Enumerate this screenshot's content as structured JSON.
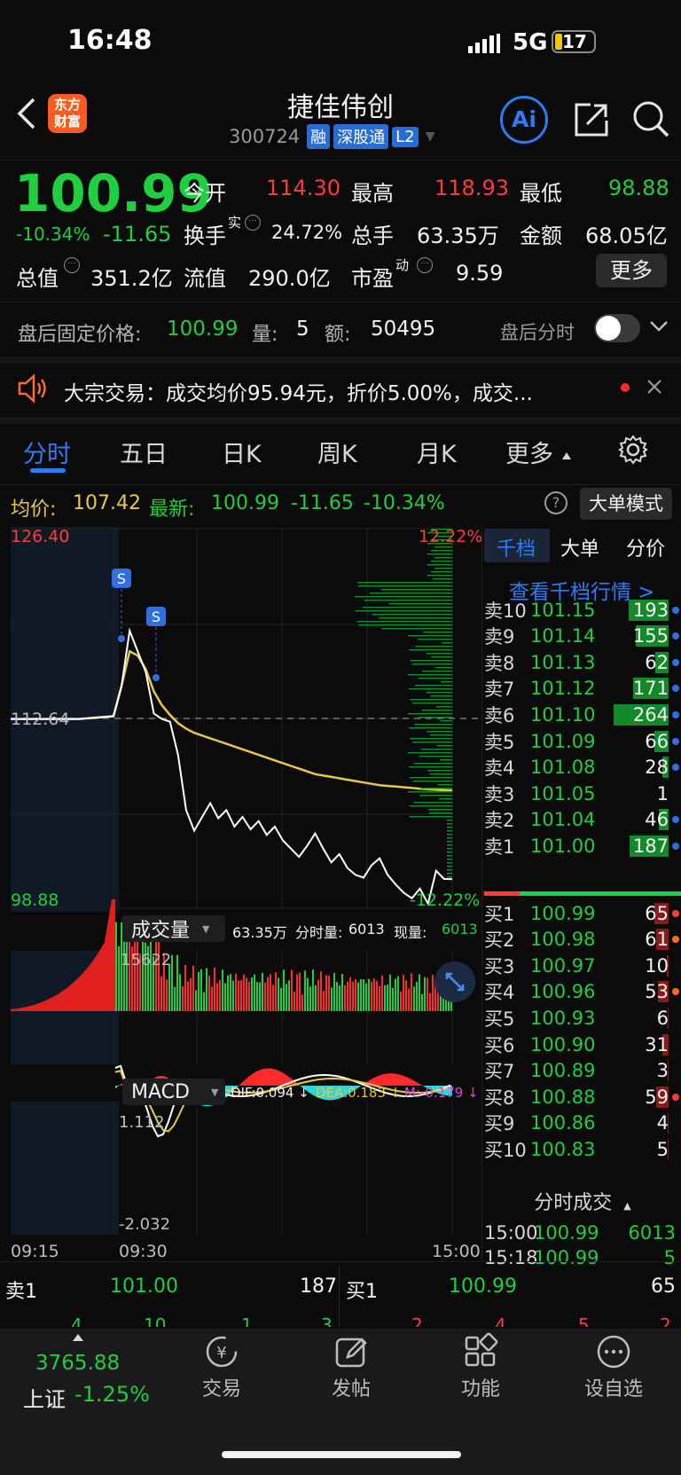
{
  "status_bar": {
    "time": "16:48",
    "network": "5G",
    "battery": "17"
  },
  "header": {
    "title": "捷佳伟创",
    "code": "300724",
    "tags": [
      "融",
      "深股通",
      "L2"
    ],
    "ai_label": "Ai"
  },
  "quote": {
    "price": "100.99",
    "change_pct": "-10.34%",
    "change": "-11.65",
    "open_label": "今开",
    "open": "114.30",
    "high_label": "最高",
    "high": "118.93",
    "low_label": "最低",
    "low": "98.88",
    "turnover_label": "换手",
    "turnover_sup": "实",
    "turnover": "24.72%",
    "volume_label": "总手",
    "volume": "63.35万",
    "amount_label": "金额",
    "amount": "68.05亿",
    "total_value_label": "总值",
    "total_value": "351.2亿",
    "float_value_label": "流值",
    "float_value": "290.0亿",
    "pe_label": "市盈",
    "pe_sup": "动",
    "pe": "9.59",
    "more_label": "更多"
  },
  "after_hours": {
    "label": "盘后固定价格:",
    "price": "100.99",
    "vol_label": "量:",
    "vol": "5",
    "amount_label": "额:",
    "amount": "50495",
    "toggle_label": "盘后分时"
  },
  "news": {
    "text": "大宗交易：成交均价95.94元，折价5.00%，成交..."
  },
  "tabs": [
    "分时",
    "五日",
    "日K",
    "周K",
    "月K",
    "更多"
  ],
  "chart_info": {
    "avg_label": "均价:",
    "avg": "107.42",
    "latest_label": "最新:",
    "latest": "100.99",
    "latest_change": "-11.65",
    "latest_pct": "-10.34%",
    "mode_label": "大单模式"
  },
  "chart_labels": {
    "y_top": "126.40",
    "y_mid": "112.64",
    "y_bottom": "98.88",
    "pct_top": "12.22%",
    "pct_bottom": "-12.22%",
    "volume_selector": "成交量",
    "volume_total": "63.35万",
    "volume_min_label": "分时量:",
    "volume_min": "6013",
    "volume_now_label": "现量:",
    "volume_now": "6013",
    "volume_max": "15622",
    "macd_selector": "MACD",
    "dif": "DIF:0.094 ↓",
    "dea": "DEA:0.183 ↓",
    "m": "M:-0.179 ↓",
    "macd_top": "1.112",
    "macd_bottom": "-2.032",
    "time_start": "09:15",
    "time_open": "09:30",
    "time_end": "15:00"
  },
  "chart_data": {
    "type": "line",
    "series": [
      {
        "name": "最新",
        "color": "#ffffff",
        "values": [
          112.6,
          112.6,
          112.6,
          112.8,
          115,
          119,
          117.5,
          116,
          113,
          112.6,
          112.4,
          110,
          106,
          104.5,
          105.5,
          106.5,
          105.4,
          106,
          104.8,
          105.5,
          104.6,
          105.2,
          104.2,
          104.8,
          103.8,
          103.2,
          102.6,
          103.4,
          104.3,
          103.2,
          102.2,
          102.8,
          101.8,
          101.3,
          101.1,
          102,
          102.5,
          101.3,
          100.6,
          100,
          99.6,
          100.3,
          99.2,
          101.6,
          101,
          100.99
        ]
      },
      {
        "name": "均价",
        "color": "#e6c84a",
        "values": [
          112.6,
          112.6,
          112.6,
          112.8,
          115,
          117.5,
          117.2,
          116.2,
          114.6,
          113.6,
          112.9,
          112.3,
          111.9,
          111.6,
          111.4,
          111.2,
          111.0,
          110.8,
          110.6,
          110.4,
          110.2,
          110.0,
          109.8,
          109.6,
          109.4,
          109.2,
          109.0,
          108.8,
          108.6,
          108.5,
          108.4,
          108.3,
          108.2,
          108.1,
          108.0,
          107.9,
          107.8,
          107.75,
          107.7,
          107.65,
          107.6,
          107.55,
          107.5,
          107.47,
          107.44,
          107.42
        ]
      }
    ],
    "ylim": [
      98.88,
      126.4
    ]
  },
  "orderbook": {
    "tabs": [
      "千档",
      "大单",
      "分价"
    ],
    "link": "查看千档行情 >",
    "asks": [
      {
        "label": "卖10",
        "price": "101.15",
        "vol": "193",
        "bar": 0.73,
        "dot": "#2f6fe0"
      },
      {
        "label": "卖9",
        "price": "101.14",
        "vol": "155",
        "bar": 0.59,
        "dot": "#2f6fe0"
      },
      {
        "label": "卖8",
        "price": "101.13",
        "vol": "62",
        "bar": 0.24,
        "dot": "#2f6fe0"
      },
      {
        "label": "卖7",
        "price": "101.12",
        "vol": "171",
        "bar": 0.65,
        "dot": "#2f6fe0"
      },
      {
        "label": "卖6",
        "price": "101.10",
        "vol": "264",
        "bar": 1.0,
        "dot": "#2f6fe0"
      },
      {
        "label": "卖5",
        "price": "101.09",
        "vol": "66",
        "bar": 0.25,
        "dot": "#2f6fe0"
      },
      {
        "label": "卖4",
        "price": "101.08",
        "vol": "28",
        "bar": 0.11,
        "dot": "#2f6fe0"
      },
      {
        "label": "卖3",
        "price": "101.05",
        "vol": "1",
        "bar": 0.0,
        "dot": ""
      },
      {
        "label": "卖2",
        "price": "101.04",
        "vol": "46",
        "bar": 0.17,
        "dot": "#2f6fe0"
      },
      {
        "label": "卖1",
        "price": "101.00",
        "vol": "187",
        "bar": 0.71,
        "dot": "#2f6fe0"
      }
    ],
    "bids": [
      {
        "label": "买1",
        "price": "100.99",
        "vol": "65",
        "bar": 0.25,
        "dot": "#ff3b3b"
      },
      {
        "label": "买2",
        "price": "100.98",
        "vol": "61",
        "bar": 0.23,
        "dot": "#ff6a2b"
      },
      {
        "label": "买3",
        "price": "100.97",
        "vol": "10",
        "bar": 0.04,
        "dot": ""
      },
      {
        "label": "买4",
        "price": "100.96",
        "vol": "53",
        "bar": 0.2,
        "dot": "#ff6a2b"
      },
      {
        "label": "买5",
        "price": "100.93",
        "vol": "6",
        "bar": 0.02,
        "dot": ""
      },
      {
        "label": "买6",
        "price": "100.90",
        "vol": "31",
        "bar": 0.12,
        "dot": ""
      },
      {
        "label": "买7",
        "price": "100.89",
        "vol": "3",
        "bar": 0.01,
        "dot": ""
      },
      {
        "label": "买8",
        "price": "100.88",
        "vol": "59",
        "bar": 0.22,
        "dot": "#ff3b3b"
      },
      {
        "label": "买9",
        "price": "100.86",
        "vol": "4",
        "bar": 0.01,
        "dot": ""
      },
      {
        "label": "买10",
        "price": "100.83",
        "vol": "5",
        "bar": 0.02,
        "dot": ""
      }
    ],
    "trades_title": "分时成交",
    "trades": [
      {
        "time": "15:00",
        "price": "100.99",
        "vol": "6013",
        "vol_color": "#1fcf3f"
      },
      {
        "time": "15:18",
        "price": "100.99",
        "vol": "5",
        "vol_color": "#1fcf3f"
      }
    ]
  },
  "bottom_quote": {
    "ask_label": "卖1",
    "ask_price": "101.00",
    "ask_vol": "187",
    "bid_label": "买1",
    "bid_price": "100.99",
    "bid_vol": "65",
    "small_left": [
      "4",
      "10",
      "1",
      "3"
    ],
    "small_right": [
      "2",
      "4",
      "5",
      "2"
    ]
  },
  "bottom_nav": {
    "index_value": "3765.88",
    "index_name": "上证",
    "index_change": "-1.25%",
    "items": [
      "交易",
      "发帖",
      "功能",
      "设自选"
    ]
  }
}
